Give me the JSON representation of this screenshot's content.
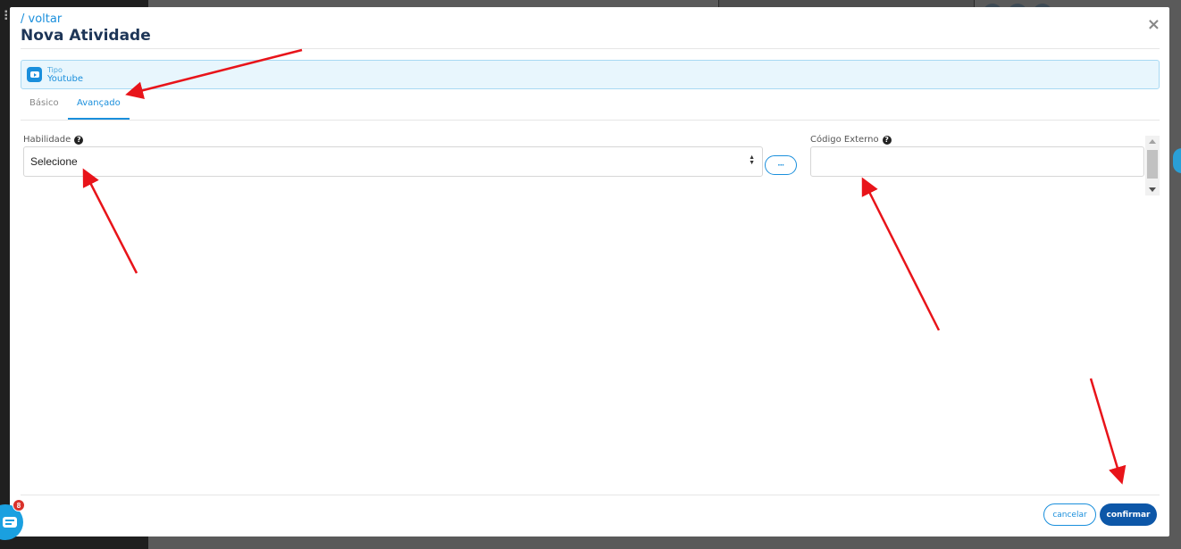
{
  "header": {
    "back_label": "/ voltar",
    "title": "Nova Atividade"
  },
  "type_banner": {
    "label": "Tipo",
    "value": "Youtube",
    "icon": "youtube-icon"
  },
  "tabs": [
    {
      "label": "Básico",
      "active": false
    },
    {
      "label": "Avançado",
      "active": true
    }
  ],
  "fields": {
    "skill": {
      "label": "Habilidade",
      "selected": "Selecione",
      "help_icon": "question-circle-icon",
      "more_button": "···"
    },
    "external_code": {
      "label": "Código Externo",
      "value": "",
      "help_icon": "question-circle-icon"
    }
  },
  "footer": {
    "cancel_label": "cancelar",
    "confirm_label": "confirmar"
  },
  "chat_widget": {
    "badge_count": "8"
  },
  "colors": {
    "accent": "#1a8fdc",
    "title": "#1d3557",
    "confirm": "#0d57a8",
    "banner_bg": "#e8f6fd",
    "annotation_arrow": "#e8141a"
  }
}
